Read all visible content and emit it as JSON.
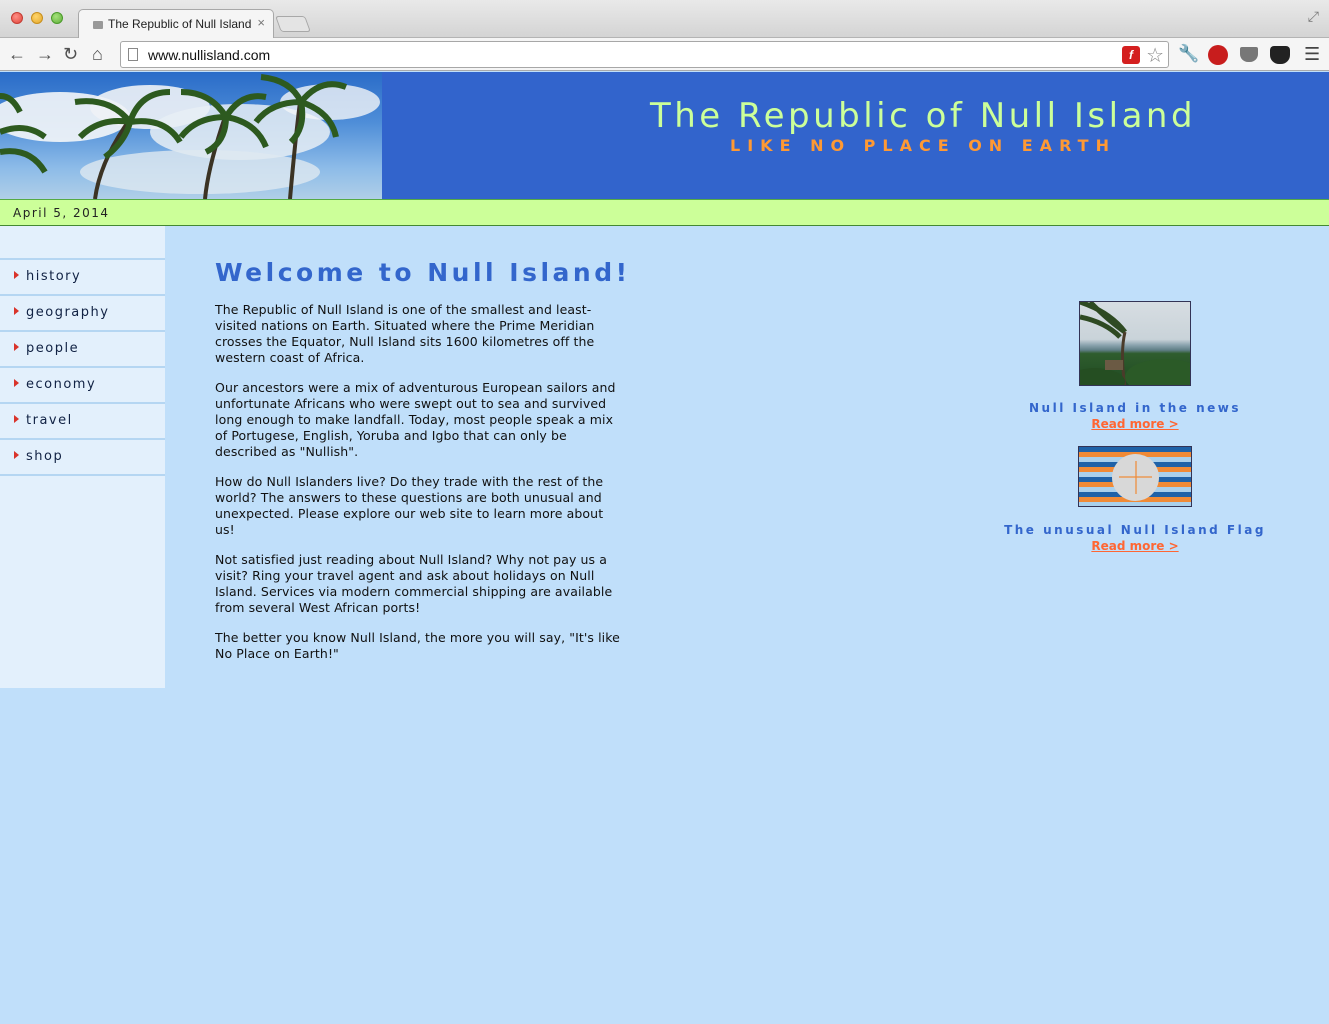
{
  "browser": {
    "tab_title": "The Republic of Null Island",
    "tab_close": "×",
    "url": "www.nullisland.com",
    "icons": [
      "back-icon",
      "forward-icon",
      "reload-icon",
      "home-icon",
      "flash-icon",
      "star-icon",
      "wrench-icon",
      "stop-icon",
      "pocket-icon",
      "cat-icon",
      "menu-icon",
      "fullscreen-icon"
    ]
  },
  "header": {
    "title": "The Republic of Null Island",
    "tagline": "LIKE NO PLACE ON EARTH",
    "date": "April 5, 2014"
  },
  "sidebar": {
    "items": [
      {
        "label": "history"
      },
      {
        "label": "geography"
      },
      {
        "label": "people"
      },
      {
        "label": "economy"
      },
      {
        "label": "travel"
      },
      {
        "label": "shop"
      }
    ]
  },
  "main": {
    "heading": "Welcome to Null Island!",
    "paragraphs": [
      "The Republic of Null Island is one of the smallest and least-visited nations on Earth. Situated where the Prime Meridian crosses the Equator, Null Island sits 1600 kilometres off the western coast of Africa.",
      "Our ancestors were a mix of adventurous European sailors and unfortunate Africans who were swept out to sea and survived long enough to make landfall. Today, most people speak a mix of Portugese, English, Yoruba and Igbo that can only be described as \"Nullish\".",
      "How do Null Islanders live? Do they trade with the rest of the world? The answers to these questions are both unusual and unexpected. Please explore our web site to learn more about us!",
      "Not satisfied just reading about Null Island? Why not pay us a visit? Ring your travel agent and ask about holidays on Null Island. Services via modern commercial shipping are available from several West African ports!",
      "The better you know Null Island, the more you will say, \"It's like No Place on Earth!\""
    ]
  },
  "features": [
    {
      "caption": "Null Island in the news",
      "link": "Read more >"
    },
    {
      "caption": "The unusual Null Island Flag",
      "link": "Read more >"
    }
  ],
  "colors": {
    "header_bg": "#3264cc",
    "title": "#ccff99",
    "tagline": "#ff9933",
    "datebar": "#ccff99",
    "page_bg": "#c0dffa",
    "sidebar_bg": "#e3f0fc",
    "heading": "#3366cc",
    "link": "#ff6633"
  }
}
